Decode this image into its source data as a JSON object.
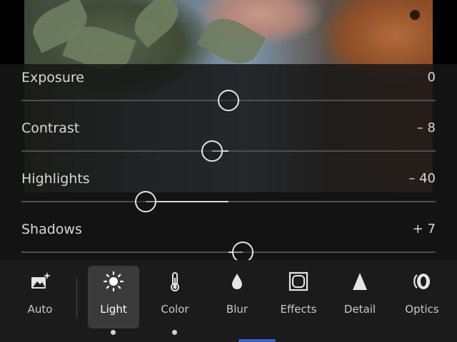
{
  "adjustments": [
    {
      "name": "Exposure",
      "value": "0",
      "level": 0
    },
    {
      "name": "Contrast",
      "value": "– 8",
      "level": -8
    },
    {
      "name": "Highlights",
      "value": "– 40",
      "level": -40
    },
    {
      "name": "Shadows",
      "value": "+ 7",
      "level": 7
    }
  ],
  "toolbar": {
    "items": [
      {
        "label": "Auto",
        "icon": "auto-enhance-icon"
      },
      {
        "label": "Light",
        "icon": "sun-icon"
      },
      {
        "label": "Color",
        "icon": "thermometer-icon"
      },
      {
        "label": "Blur",
        "icon": "droplet-icon"
      },
      {
        "label": "Effects",
        "icon": "effects-frame-icon"
      },
      {
        "label": "Detail",
        "icon": "triangle-icon"
      },
      {
        "label": "Optics",
        "icon": "lens-icon"
      }
    ],
    "active": "Light"
  },
  "colors": {
    "accent": "#3563c9",
    "panel": "#161616",
    "text": "#d8d8d8"
  }
}
